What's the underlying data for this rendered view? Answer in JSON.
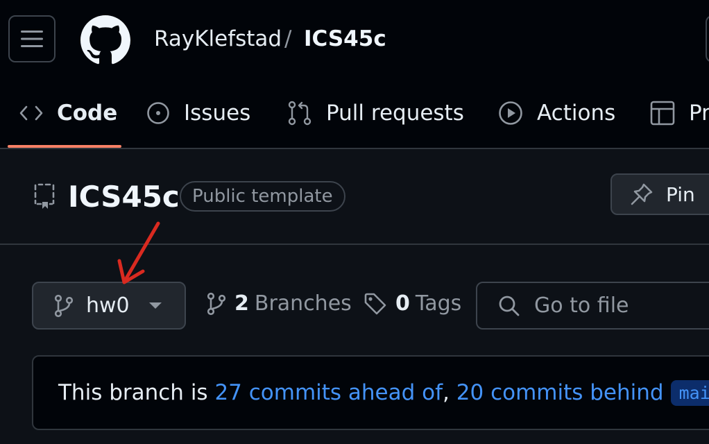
{
  "header": {
    "owner": "RayKlefstad",
    "separator": "/",
    "repo": "ICS45c"
  },
  "tabs": [
    {
      "label": "Code",
      "icon": "code-icon",
      "active": true
    },
    {
      "label": "Issues",
      "icon": "issue-opened-icon"
    },
    {
      "label": "Pull requests",
      "icon": "git-pull-request-icon"
    },
    {
      "label": "Actions",
      "icon": "play-icon"
    },
    {
      "label": "Pr",
      "icon": "table-icon"
    }
  ],
  "repo_header": {
    "title": "ICS45c",
    "badge": "Public template",
    "pin_label": "Pin"
  },
  "branch_bar": {
    "current_branch": "hw0",
    "branches_count": "2",
    "branches_label": "Branches",
    "tags_count": "0",
    "tags_label": "Tags",
    "search_placeholder": "Go to file"
  },
  "compare": {
    "prefix": "This branch is ",
    "ahead_link": "27 commits ahead of",
    "comma": ", ",
    "behind_link": "20 commits behind",
    "base_branch": "main",
    "suffix": "."
  },
  "colors": {
    "accent_underline": "#f78166",
    "link": "#4493f8",
    "annotation_arrow": "#d92a20"
  }
}
